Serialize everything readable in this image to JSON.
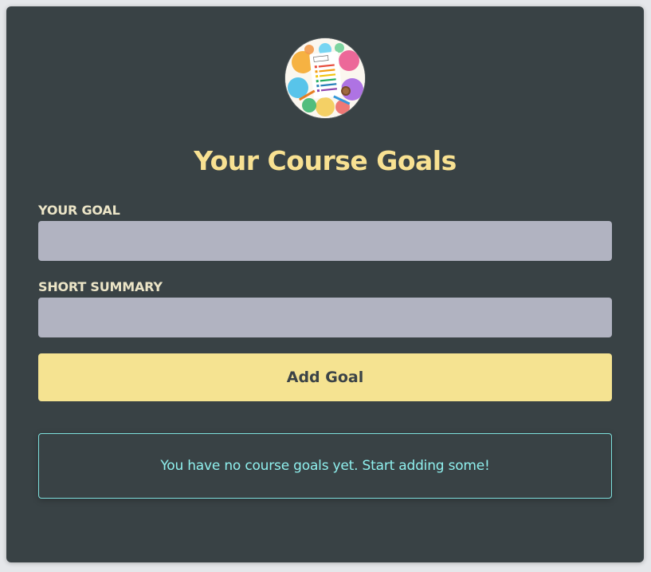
{
  "app": {
    "title": "Your Course Goals",
    "logo_icon": "goals-checklist-illustration"
  },
  "form": {
    "goal_label": "YOUR GOAL",
    "goal_value": "",
    "summary_label": "SHORT SUMMARY",
    "summary_value": "",
    "submit_label": "Add Goal"
  },
  "goals": {
    "empty_message": "You have no course goals yet. Start adding some!",
    "items": []
  },
  "colors": {
    "card_background": "#394245",
    "title": "#f8e192",
    "button": "#f5e391",
    "input": "#b1b3c1",
    "empty_border": "#7ee0dd"
  }
}
